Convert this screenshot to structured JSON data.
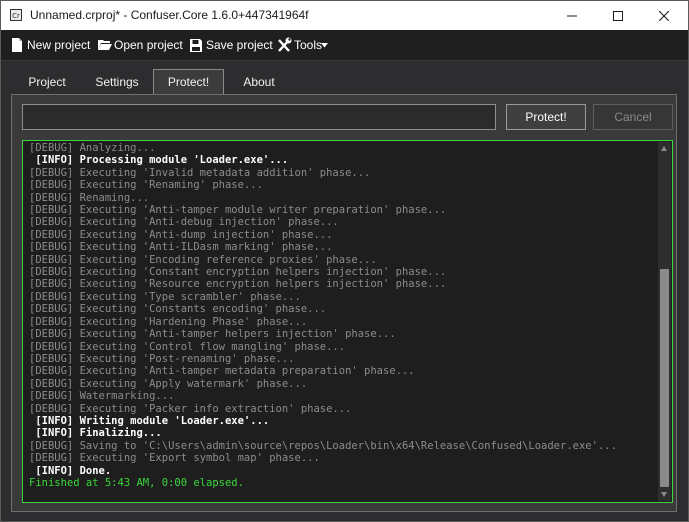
{
  "window": {
    "title": "Unnamed.crproj* - Confuser.Core 1.6.0+447341964f",
    "app_icon_text": "Cr",
    "icons": {
      "minimize": "minimize-icon",
      "maximize": "maximize-icon",
      "close": "close-icon"
    }
  },
  "toolbar": {
    "new_project": "New project",
    "open_project": "Open project",
    "save_project": "Save project",
    "tools": "Tools",
    "icons": {
      "new": "new-file-icon",
      "open": "folder-open-icon",
      "save": "floppy-disk-icon",
      "tools": "tools-icon",
      "dropdown": "caret-down-icon"
    }
  },
  "tabs": [
    {
      "label": "Project",
      "active": false
    },
    {
      "label": "Settings",
      "active": false
    },
    {
      "label": "Protect!",
      "active": true
    },
    {
      "label": "About",
      "active": false
    }
  ],
  "protect": {
    "input_value": "",
    "protect_label": "Protect!",
    "cancel_label": "Cancel",
    "cancel_enabled": false
  },
  "colors": {
    "accent_border": "#3fd43f",
    "done_text": "#3ad83a",
    "debug_text": "#8c8c8c",
    "info_text": "#ffffff"
  },
  "log": {
    "lines": [
      {
        "level": "debug",
        "text": "[DEBUG] Analyzing..."
      },
      {
        "level": "info",
        "text": " [INFO] Processing module 'Loader.exe'..."
      },
      {
        "level": "debug",
        "text": "[DEBUG] Executing 'Invalid metadata addition' phase..."
      },
      {
        "level": "debug",
        "text": "[DEBUG] Executing 'Renaming' phase..."
      },
      {
        "level": "debug",
        "text": "[DEBUG] Renaming..."
      },
      {
        "level": "debug",
        "text": "[DEBUG] Executing 'Anti-tamper module writer preparation' phase..."
      },
      {
        "level": "debug",
        "text": "[DEBUG] Executing 'Anti-debug injection' phase..."
      },
      {
        "level": "debug",
        "text": "[DEBUG] Executing 'Anti-dump injection' phase..."
      },
      {
        "level": "debug",
        "text": "[DEBUG] Executing 'Anti-ILDasm marking' phase..."
      },
      {
        "level": "debug",
        "text": "[DEBUG] Executing 'Encoding reference proxies' phase..."
      },
      {
        "level": "debug",
        "text": "[DEBUG] Executing 'Constant encryption helpers injection' phase..."
      },
      {
        "level": "debug",
        "text": "[DEBUG] Executing 'Resource encryption helpers injection' phase..."
      },
      {
        "level": "debug",
        "text": "[DEBUG] Executing 'Type scrambler' phase..."
      },
      {
        "level": "debug",
        "text": "[DEBUG] Executing 'Constants encoding' phase..."
      },
      {
        "level": "debug",
        "text": "[DEBUG] Executing 'Hardening Phase' phase..."
      },
      {
        "level": "debug",
        "text": "[DEBUG] Executing 'Anti-tamper helpers injection' phase..."
      },
      {
        "level": "debug",
        "text": "[DEBUG] Executing 'Control flow mangling' phase..."
      },
      {
        "level": "debug",
        "text": "[DEBUG] Executing 'Post-renaming' phase..."
      },
      {
        "level": "debug",
        "text": "[DEBUG] Executing 'Anti-tamper metadata preparation' phase..."
      },
      {
        "level": "debug",
        "text": "[DEBUG] Executing 'Apply watermark' phase..."
      },
      {
        "level": "debug",
        "text": "[DEBUG] Watermarking..."
      },
      {
        "level": "debug",
        "text": "[DEBUG] Executing 'Packer info extraction' phase..."
      },
      {
        "level": "info",
        "text": " [INFO] Writing module 'Loader.exe'..."
      },
      {
        "level": "info",
        "text": " [INFO] Finalizing..."
      },
      {
        "level": "debug",
        "text": "[DEBUG] Saving to 'C:\\Users\\admin\\source\\repos\\Loader\\bin\\x64\\Release\\Confused\\Loader.exe'..."
      },
      {
        "level": "debug",
        "text": "[DEBUG] Executing 'Export symbol map' phase..."
      },
      {
        "level": "info",
        "text": " [INFO] Done."
      },
      {
        "level": "done",
        "text": "Finished at 5:43 AM, 0:00 elapsed."
      }
    ]
  }
}
